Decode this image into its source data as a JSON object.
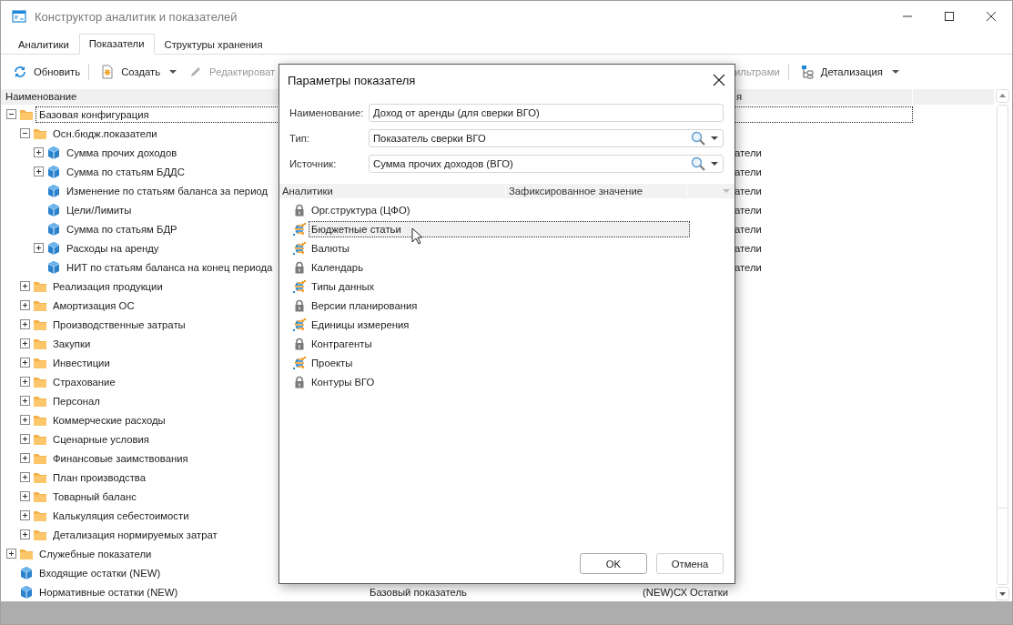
{
  "window": {
    "title": "Конструктор аналитик и показателей"
  },
  "tabs": [
    {
      "label": "Аналитики",
      "selected": false
    },
    {
      "label": "Показатели",
      "selected": true
    },
    {
      "label": "Структуры хранения",
      "selected": false
    }
  ],
  "toolbar": [
    {
      "kind": "refresh",
      "label": "Обновить",
      "disabled": false
    },
    {
      "kind": "separator"
    },
    {
      "kind": "create",
      "label": "Создать",
      "disabled": false,
      "dropdown": true
    },
    {
      "kind": "edit",
      "label": "Редактироват",
      "disabled": true
    },
    {
      "kind": "tail",
      "label": "ильтрами",
      "disabled": true
    },
    {
      "kind": "separator"
    },
    {
      "kind": "detail",
      "label": "Детализация",
      "disabled": false,
      "dropdown": true
    }
  ],
  "table": {
    "columns": [
      {
        "kind": "full",
        "label": "Наименование"
      },
      {
        "kind": "tail",
        "label": "я"
      }
    ],
    "tree": [
      {
        "kind": "folder",
        "name": "Базовая конфигурация",
        "expanded": true,
        "focused": true,
        "children": [
          {
            "kind": "folder",
            "name": "Осн.бюдж.показатели",
            "expanded": true,
            "children": [
              {
                "kind": "cube",
                "name": "Сумма прочих доходов",
                "expanded": false,
                "column_3_tail": "атели"
              },
              {
                "kind": "cube",
                "name": "Сумма по статьям БДДС",
                "expanded": false,
                "column_3_tail": "атели"
              },
              {
                "kind": "cube",
                "name": "Изменение по статьям баланса за период",
                "column_3_tail": "атели"
              },
              {
                "kind": "cube",
                "name": "Цели/Лимиты",
                "column_3_tail": "атели"
              },
              {
                "kind": "cube",
                "name": "Сумма по статьям БДР",
                "column_3_tail": "атели"
              },
              {
                "kind": "cube",
                "name": "Расходы на аренду",
                "expanded": false,
                "column_3_tail": "атели"
              },
              {
                "kind": "cube",
                "name": "НИТ по статьям баланса на конец периода",
                "column_3_tail": "атели"
              }
            ]
          },
          {
            "kind": "folder",
            "name": "Реализация продукции",
            "expanded": false
          },
          {
            "kind": "folder",
            "name": "Амортизация ОС",
            "expanded": false
          },
          {
            "kind": "folder",
            "name": "Производственные затраты",
            "expanded": false
          },
          {
            "kind": "folder",
            "name": "Закупки",
            "expanded": false
          },
          {
            "kind": "folder",
            "name": "Инвестиции",
            "expanded": false
          },
          {
            "kind": "folder",
            "name": "Страхование",
            "expanded": false
          },
          {
            "kind": "folder",
            "name": "Персонал",
            "expanded": false
          },
          {
            "kind": "folder",
            "name": "Коммерческие расходы",
            "expanded": false
          },
          {
            "kind": "folder",
            "name": "Сценарные условия",
            "expanded": false
          },
          {
            "kind": "folder",
            "name": "Финансовые заимствования",
            "expanded": false
          },
          {
            "kind": "folder",
            "name": "План производства",
            "expanded": false
          },
          {
            "kind": "folder",
            "name": "Товарный баланс",
            "expanded": false
          },
          {
            "kind": "folder",
            "name": "Калькуляция себестоимости",
            "expanded": false
          },
          {
            "kind": "folder",
            "name": "Детализация нормируемых затрат",
            "expanded": false
          }
        ]
      },
      {
        "kind": "folder",
        "name": "Служебные показатели",
        "expanded": false
      },
      {
        "kind": "cube",
        "name": "Входящие остатки (NEW)"
      },
      {
        "kind": "cube",
        "name": "Нормативные остатки (NEW)",
        "column_2": "Базовый показатель",
        "column_3": "(NEW)СХ Остатки"
      }
    ]
  },
  "dialog": {
    "title": "Параметры показателя",
    "fields": [
      {
        "kind": "text",
        "label": "Наименование:",
        "value": "Доход от аренды (для сверки ВГО)"
      },
      {
        "kind": "combo",
        "label": "Тип:",
        "value": "Показатель сверки ВГО"
      },
      {
        "kind": "combo",
        "label": "Источник:",
        "value": "Сумма прочих доходов (ВГО)"
      }
    ],
    "columns": [
      {
        "label": "Аналитики"
      },
      {
        "label": "Зафиксированное значение"
      }
    ],
    "analytics": [
      {
        "kind": "locked",
        "label": "Орг.структура (ЦФО)",
        "selected": false
      },
      {
        "kind": "linked",
        "label": "Бюджетные статьи",
        "selected": true
      },
      {
        "kind": "linked",
        "label": "Валюты",
        "selected": false
      },
      {
        "kind": "locked",
        "label": "Календарь",
        "selected": false
      },
      {
        "kind": "linked",
        "label": "Типы данных",
        "selected": false
      },
      {
        "kind": "locked",
        "label": "Версии планирования",
        "selected": false
      },
      {
        "kind": "linked",
        "label": "Единицы измерения",
        "selected": false
      },
      {
        "kind": "locked",
        "label": "Контрагенты",
        "selected": false
      },
      {
        "kind": "linked",
        "label": "Проекты",
        "selected": false
      },
      {
        "kind": "locked",
        "label": "Контуры ВГО",
        "selected": false
      }
    ],
    "buttons": [
      {
        "kind": "ok",
        "label": "OK"
      },
      {
        "kind": "cancel",
        "label": "Отмена"
      }
    ]
  }
}
